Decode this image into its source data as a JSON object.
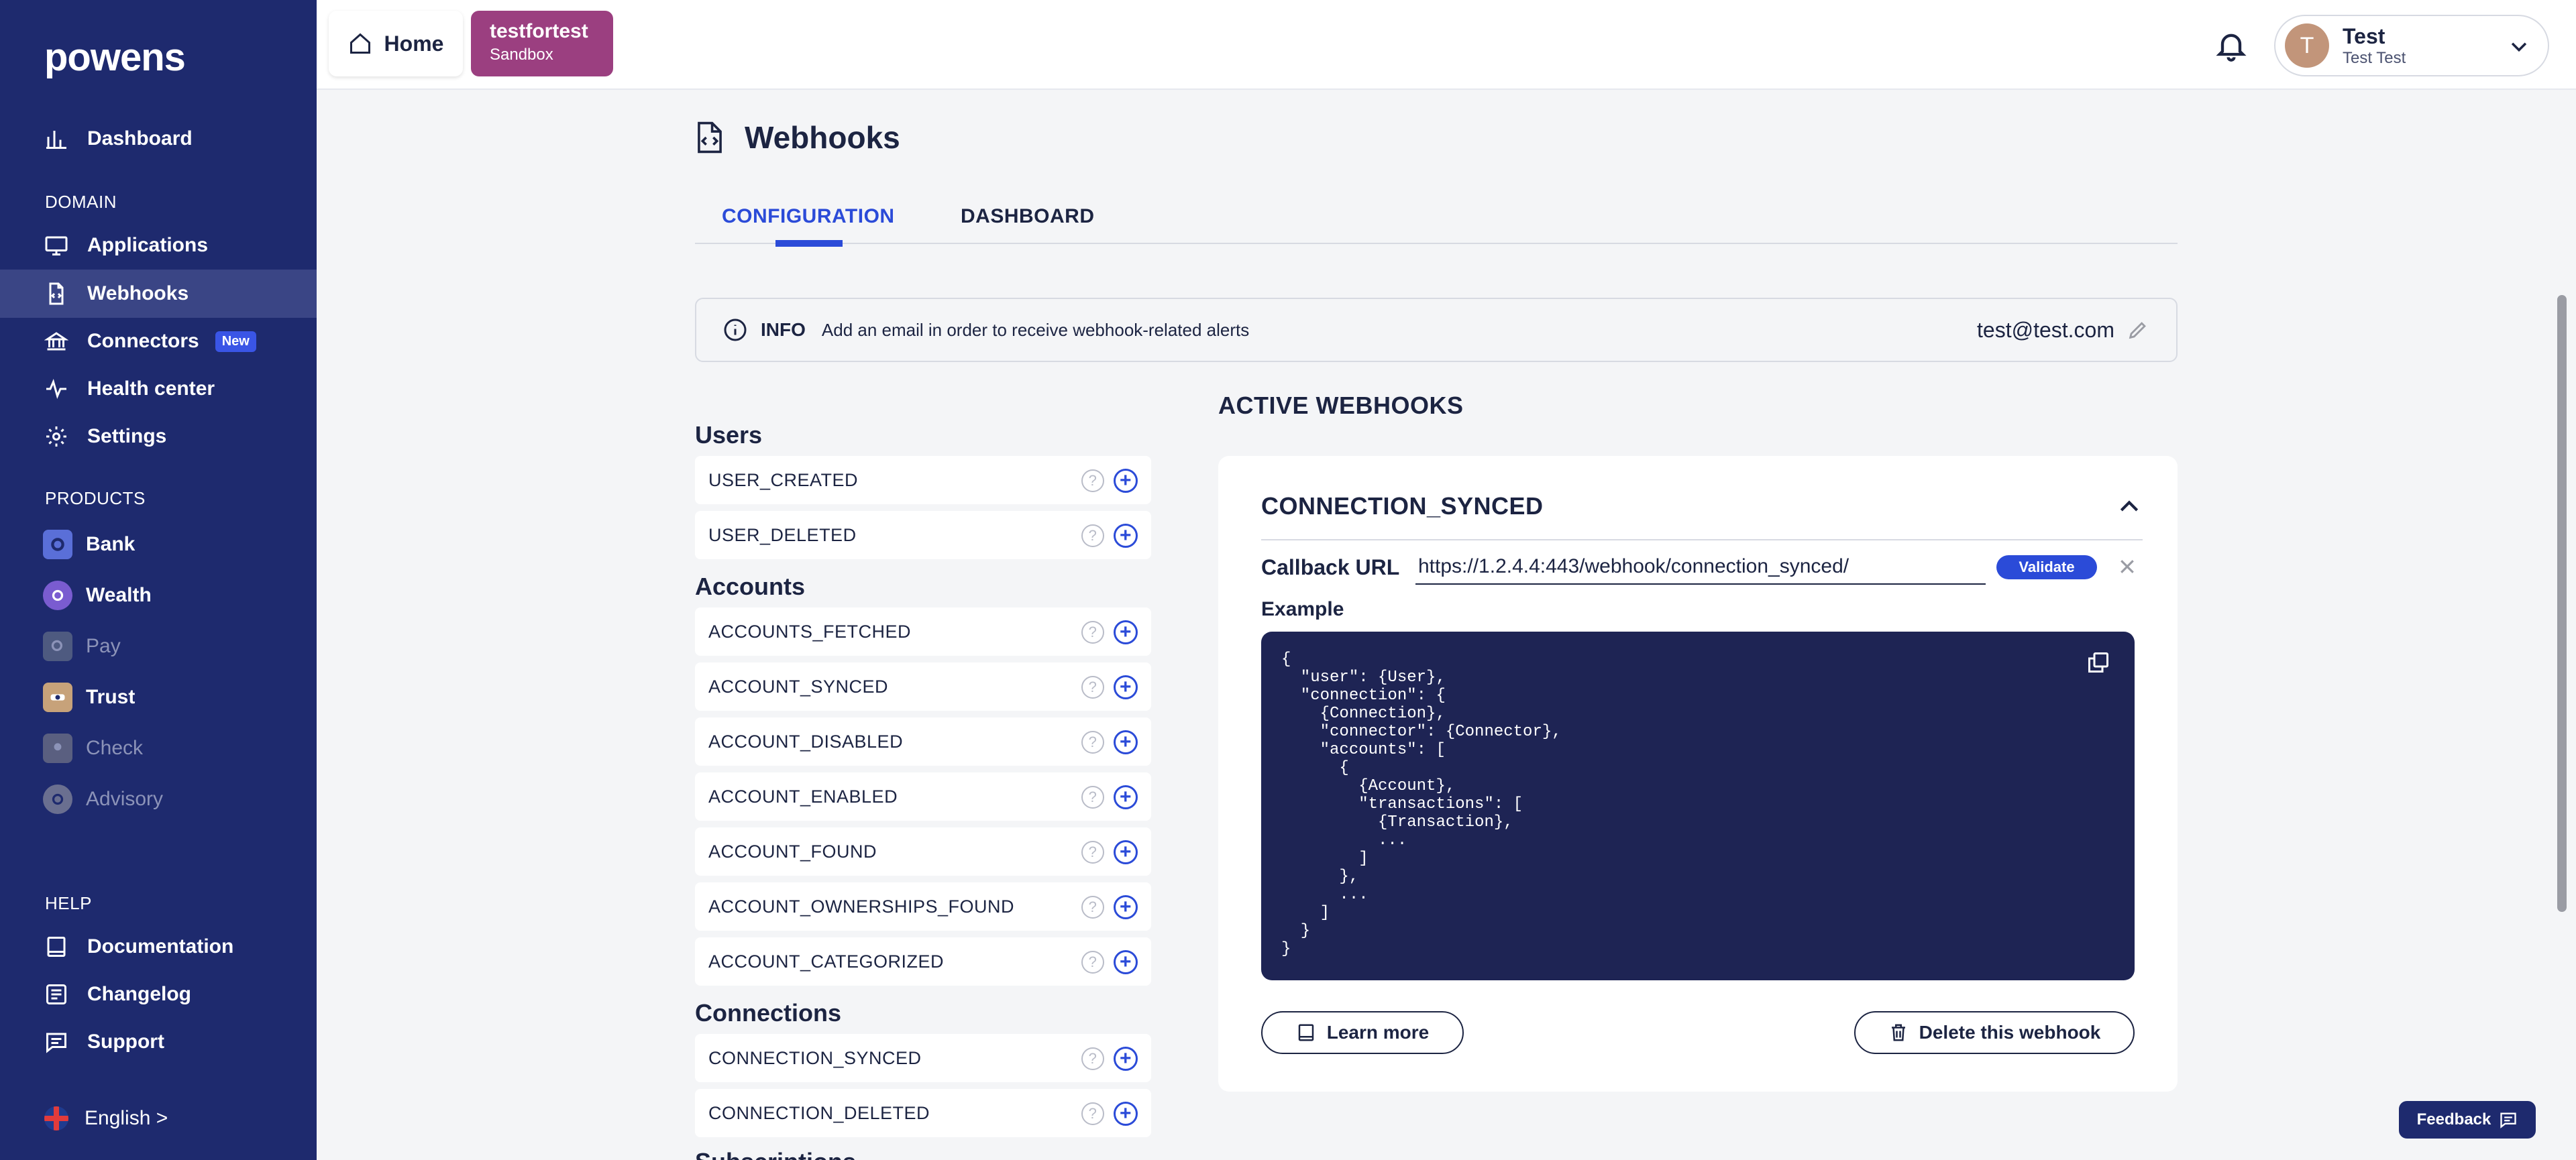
{
  "brand": {
    "logo": "powens"
  },
  "sidebar": {
    "main": [
      {
        "label": "Dashboard"
      }
    ],
    "domain_title": "DOMAIN",
    "domain": [
      {
        "label": "Applications"
      },
      {
        "label": "Webhooks"
      },
      {
        "label": "Connectors",
        "badge": "New"
      },
      {
        "label": "Health center"
      },
      {
        "label": "Settings"
      }
    ],
    "products_title": "PRODUCTS",
    "products": [
      {
        "label": "Bank"
      },
      {
        "label": "Wealth"
      },
      {
        "label": "Pay"
      },
      {
        "label": "Trust"
      },
      {
        "label": "Check"
      },
      {
        "label": "Advisory"
      }
    ],
    "help_title": "HELP",
    "help": [
      {
        "label": "Documentation"
      },
      {
        "label": "Changelog"
      },
      {
        "label": "Support"
      }
    ],
    "language": "English >"
  },
  "topbar": {
    "home": "Home",
    "env_name": "testfortest",
    "env_type": "Sandbox",
    "user_initial": "T",
    "user_name": "Test",
    "user_sub": "Test Test"
  },
  "page": {
    "title": "Webhooks",
    "tabs": [
      {
        "label": "CONFIGURATION"
      },
      {
        "label": "DASHBOARD"
      }
    ],
    "info_label": "INFO",
    "info_text": "Add an email in order to receive webhook-related alerts",
    "info_email": "test@test.com"
  },
  "events": {
    "users_title": "Users",
    "users": [
      "USER_CREATED",
      "USER_DELETED"
    ],
    "accounts_title": "Accounts",
    "accounts": [
      "ACCOUNTS_FETCHED",
      "ACCOUNT_SYNCED",
      "ACCOUNT_DISABLED",
      "ACCOUNT_ENABLED",
      "ACCOUNT_FOUND",
      "ACCOUNT_OWNERSHIPS_FOUND",
      "ACCOUNT_CATEGORIZED"
    ],
    "connections_title": "Connections",
    "connections": [
      "CONNECTION_SYNCED",
      "CONNECTION_DELETED"
    ],
    "next_title": "Subscriptions"
  },
  "active": {
    "title": "ACTIVE WEBHOOKS",
    "webhook_name": "CONNECTION_SYNCED",
    "callback_label": "Callback URL",
    "callback_value": "https://1.2.4.4:443/webhook/connection_synced/",
    "validate": "Validate",
    "example_label": "Example",
    "example_code": "{\n  \"user\": {User},\n  \"connection\": {\n    {Connection},\n    \"connector\": {Connector},\n    \"accounts\": [\n      {\n        {Account},\n        \"transactions\": [\n          {Transaction},\n          ...\n        ]\n      },\n      ...\n    ]\n  }\n}",
    "learn_more": "Learn more",
    "delete": "Delete this webhook"
  },
  "feedback": "Feedback",
  "colors": {
    "sidebar": "#1e2a6e",
    "accent": "#2b4bd8",
    "env": "#9b3f80"
  }
}
